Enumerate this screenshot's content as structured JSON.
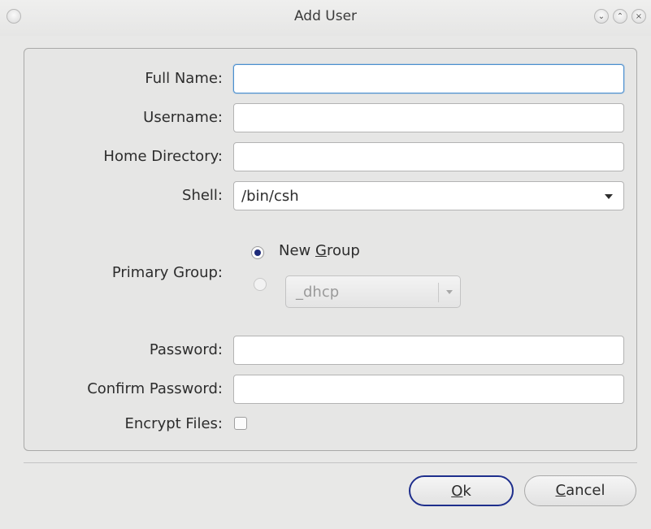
{
  "window": {
    "title": "Add User",
    "menu_icon": "window-menu-icon",
    "controls": [
      "minimize-icon",
      "maximize-icon",
      "close-icon"
    ]
  },
  "form": {
    "full_name": {
      "label": "Full Name:",
      "value": ""
    },
    "username": {
      "label": "Username:",
      "value": ""
    },
    "home_directory": {
      "label": "Home Directory:",
      "value": ""
    },
    "shell": {
      "label": "Shell:",
      "value": "/bin/csh"
    },
    "primary_group": {
      "label": "Primary Group:",
      "options": [
        {
          "label_prefix": "New ",
          "mnemonic": "G",
          "label_suffix": "roup",
          "selected": true
        },
        {
          "combo_value": "_dhcp",
          "selected": false,
          "enabled": false
        }
      ]
    },
    "password": {
      "label": "Password:",
      "value": ""
    },
    "confirm_password": {
      "label": "Confirm Password:",
      "value": ""
    },
    "encrypt_files": {
      "label": "Encrypt Files:",
      "checked": false
    }
  },
  "buttons": {
    "ok": {
      "mnemonic": "O",
      "rest": "k"
    },
    "cancel": {
      "mnemonic": "C",
      "rest": "ancel"
    }
  },
  "colors": {
    "focus_border": "#4a8fd0",
    "radio_selected": "#1e2b7a",
    "default_button_border": "#1e2e8c"
  }
}
